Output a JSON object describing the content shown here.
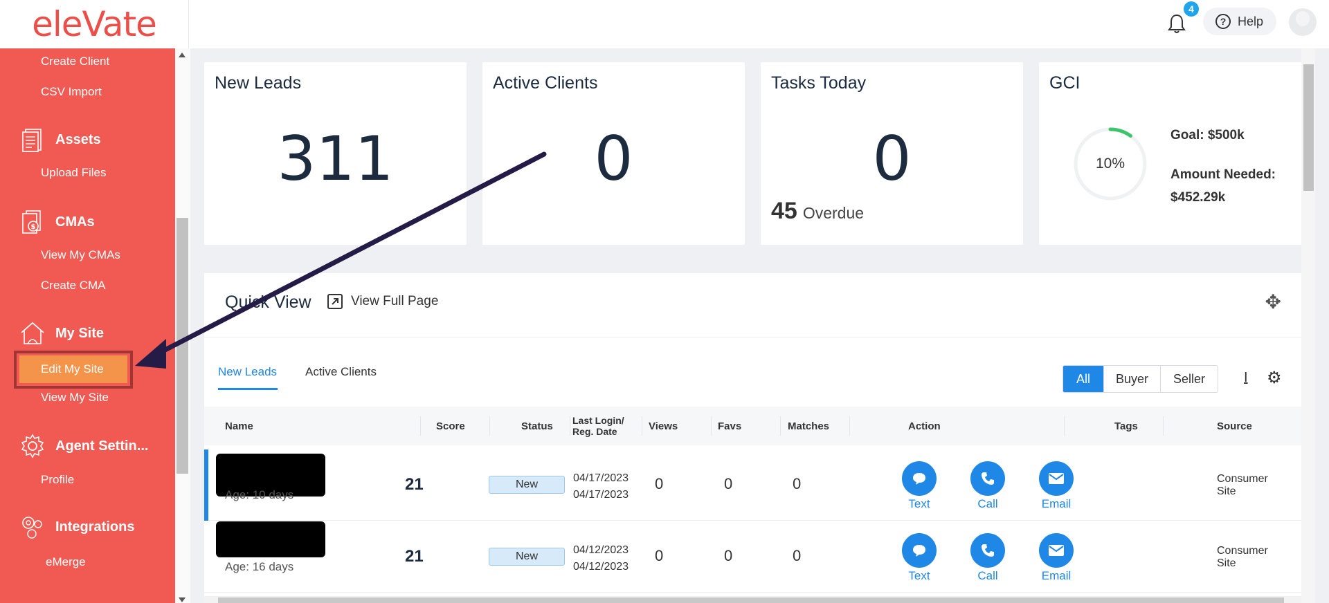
{
  "header": {
    "logo": "eleVate",
    "notification_count": "4",
    "help_label": "Help"
  },
  "sidebar": {
    "create_client": "Create Client",
    "csv_import": "CSV Import",
    "assets": "Assets",
    "upload_files": "Upload Files",
    "cmas": "CMAs",
    "view_my_cmas": "View My CMAs",
    "create_cma": "Create CMA",
    "my_site": "My Site",
    "edit_my_site": "Edit My Site",
    "view_my_site": "View My Site",
    "agent_settings": "Agent Settin...",
    "profile": "Profile",
    "integrations": "Integrations",
    "emerge": "eMerge"
  },
  "cards": {
    "new_leads": {
      "title": "New Leads",
      "value": "311"
    },
    "active_clients": {
      "title": "Active Clients",
      "value": "0"
    },
    "tasks_today": {
      "title": "Tasks Today",
      "value": "0",
      "overdue_count": "45",
      "overdue_label": "Overdue"
    },
    "gci": {
      "title": "GCI",
      "percent": "10%",
      "progress": 0.1,
      "goal": "Goal: $500k",
      "amount_needed_label": "Amount Needed:",
      "amount_needed_value": "$452.29k"
    }
  },
  "quick_view": {
    "title": "Quick View",
    "view_full_page": "View Full Page",
    "tabs": [
      "New Leads",
      "Active Clients"
    ],
    "filters": [
      "All",
      "Buyer",
      "Seller"
    ],
    "columns": {
      "name": "Name",
      "score": "Score",
      "status": "Status",
      "last_login_1": "Last Login/",
      "last_login_2": "Reg. Date",
      "views": "Views",
      "favs": "Favs",
      "matches": "Matches",
      "action": "Action",
      "tags": "Tags",
      "source": "Source"
    },
    "rows": [
      {
        "age": "Age: 10 days",
        "score": "21",
        "status": "New",
        "last_login": "04/17/2023",
        "reg_date": "04/17/2023",
        "views": "0",
        "favs": "0",
        "matches": "0",
        "text": "Text",
        "call": "Call",
        "email": "Email",
        "source_1": "Consumer",
        "source_2": "Site"
      },
      {
        "age": "Age: 16 days",
        "score": "21",
        "status": "New",
        "last_login": "04/12/2023",
        "reg_date": "04/12/2023",
        "views": "0",
        "favs": "0",
        "matches": "0",
        "text": "Text",
        "call": "Call",
        "email": "Email",
        "source_1": "Consumer",
        "source_2": "Site"
      }
    ]
  },
  "colors": {
    "sidebar": "#f05a52",
    "accent": "#1f87e5",
    "highlight": "#f4934a",
    "annotation_arrow": "#241c47"
  }
}
